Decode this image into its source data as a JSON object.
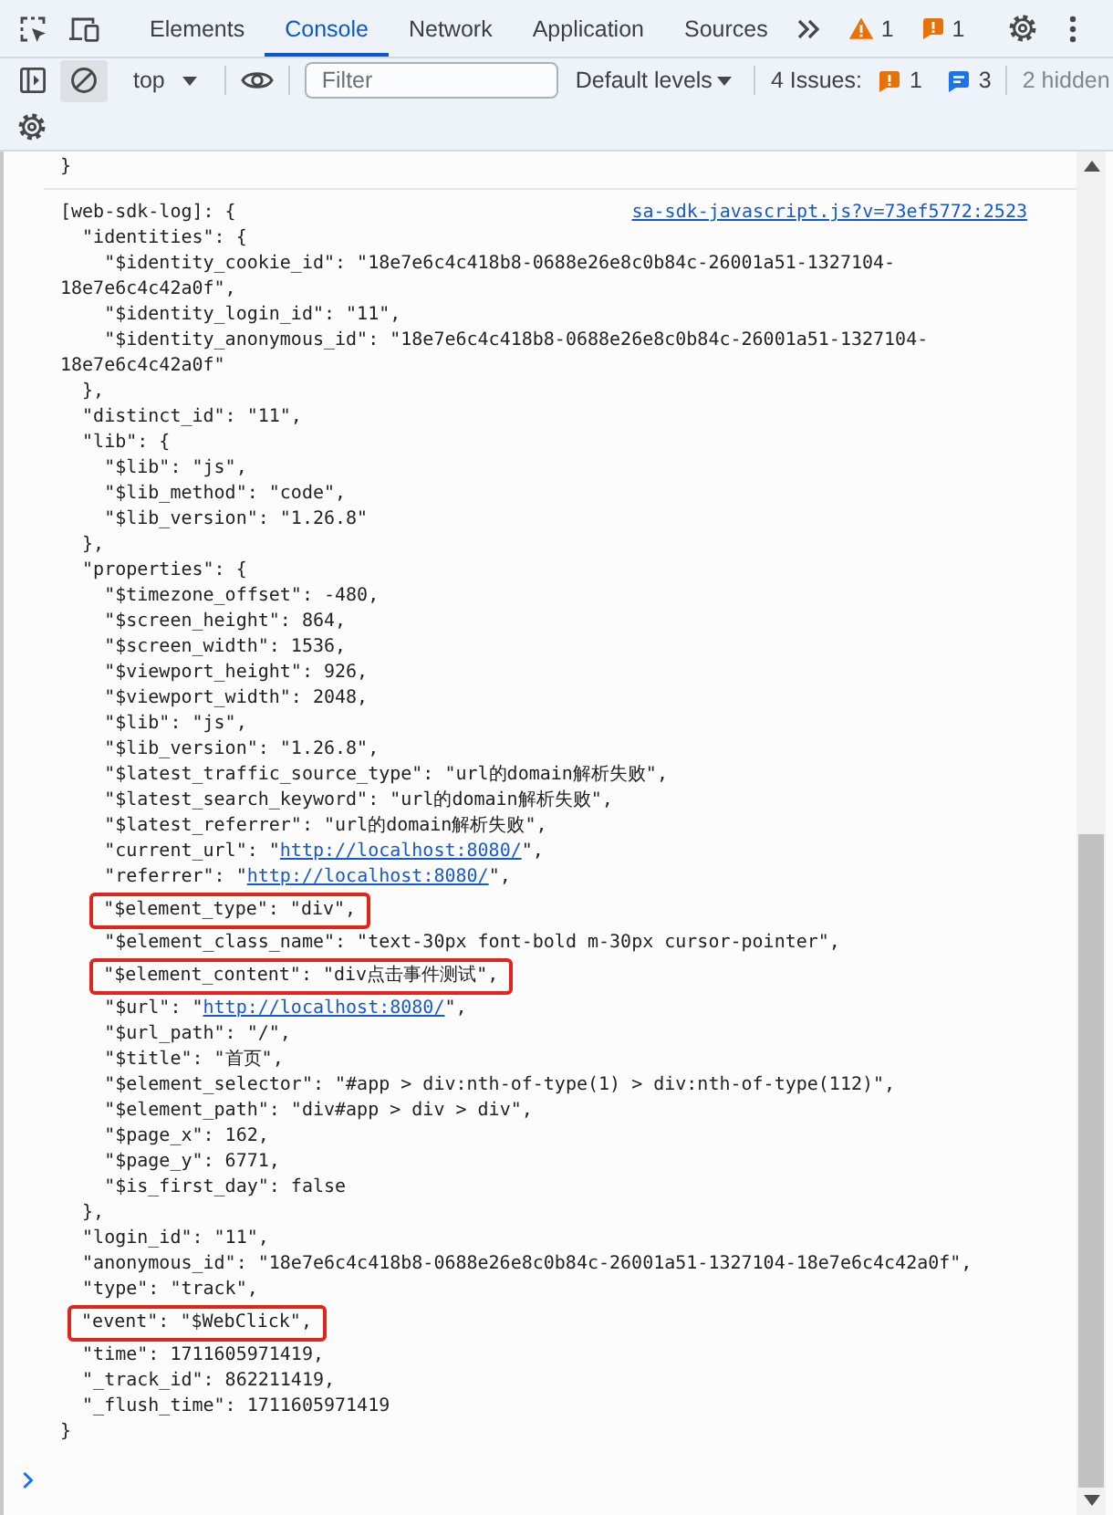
{
  "toolbar": {
    "tabs": [
      {
        "label": "Elements",
        "selected": false
      },
      {
        "label": "Console",
        "selected": true
      },
      {
        "label": "Network",
        "selected": false
      },
      {
        "label": "Application",
        "selected": false
      },
      {
        "label": "Sources",
        "selected": false
      }
    ],
    "warning_count": "1",
    "issue_count": "1"
  },
  "console_toolbar": {
    "clear_button": {
      "hovered": true
    },
    "context": "top",
    "filter": {
      "placeholder": "Filter"
    },
    "levels": "Default levels",
    "issues": {
      "label": "4 Issues:",
      "errors": "1",
      "messages": "3"
    },
    "hidden": "2 hidden"
  },
  "console": {
    "entries": [
      {
        "lines": [
          {
            "text": "}",
            "highlighted": false
          }
        ]
      },
      {
        "source": "sa-sdk-javascript.js?v=73ef5772:2523",
        "lines": [
          {
            "text": "[web-sdk-log]: {",
            "highlighted": false,
            "children": [
              {
                "text": "\"identities\": {",
                "highlighted": false,
                "children": [
                  {
                    "text": "\"$identity_cookie_id\": \"18e7e6c4c418b8-0688e26e8c0b84c-26001a51-1327104-18e7e6c4c42a0f\",",
                    "highlighted": false
                  },
                  {
                    "text": "\"$identity_login_id\": \"11\",",
                    "highlighted": false
                  },
                  {
                    "text": "\"$identity_anonymous_id\": \"18e7e6c4c418b8-0688e26e8c0b84c-26001a51-1327104-18e7e6c4c42a0f\"",
                    "highlighted": false
                  }
                ]
              },
              {
                "text": "},",
                "highlighted": false
              },
              {
                "text": "\"distinct_id\": \"11\",",
                "highlighted": false
              },
              {
                "text": "\"lib\": {",
                "highlighted": false,
                "children": [
                  {
                    "text": "\"$lib\": \"js\",",
                    "highlighted": false
                  },
                  {
                    "text": "\"$lib_method\": \"code\",",
                    "highlighted": false
                  },
                  {
                    "text": "\"$lib_version\": \"1.26.8\"",
                    "highlighted": false
                  }
                ]
              },
              {
                "text": "},",
                "highlighted": false
              },
              {
                "text": "\"properties\": {",
                "highlighted": false,
                "children": [
                  {
                    "text": "\"$timezone_offset\": -480,",
                    "highlighted": false
                  },
                  {
                    "text": "\"$screen_height\": 864,",
                    "highlighted": false
                  },
                  {
                    "text": "\"$screen_width\": 1536,",
                    "highlighted": false
                  },
                  {
                    "text": "\"$viewport_height\": 926,",
                    "highlighted": false
                  },
                  {
                    "text": "\"$viewport_width\": 2048,",
                    "highlighted": false
                  },
                  {
                    "text": "\"$lib\": \"js\",",
                    "highlighted": false
                  },
                  {
                    "text": "\"$lib_version\": \"1.26.8\",",
                    "highlighted": false
                  },
                  {
                    "text": "\"$latest_traffic_source_type\": \"url的domain解析失败\",",
                    "highlighted": false
                  },
                  {
                    "text": "\"$latest_search_keyword\": \"url的domain解析失败\",",
                    "highlighted": false
                  },
                  {
                    "text": "\"$latest_referrer\": \"url的domain解析失败\",",
                    "highlighted": false
                  },
                  {
                    "text": "\"current_url\": \"",
                    "link": "http://localhost:8080/",
                    "tail": "\",",
                    "highlighted": false
                  },
                  {
                    "text": "\"referrer\": \"",
                    "link": "http://localhost:8080/",
                    "tail": "\",",
                    "highlighted": false
                  },
                  {
                    "text": "\"$element_type\": \"div\",",
                    "highlighted": true
                  },
                  {
                    "text": "\"$element_class_name\": \"text-30px font-bold m-30px cursor-pointer\",",
                    "highlighted": false
                  },
                  {
                    "text": "\"$element_content\": \"div点击事件测试\",",
                    "highlighted": true
                  },
                  {
                    "text": "\"$url\": \"",
                    "link": "http://localhost:8080/",
                    "tail": "\",",
                    "highlighted": false
                  },
                  {
                    "text": "\"$url_path\": \"/\",",
                    "highlighted": false
                  },
                  {
                    "text": "\"$title\": \"首页\",",
                    "highlighted": false
                  },
                  {
                    "text": "\"$element_selector\": \"#app > div:nth-of-type(1) > div:nth-of-type(112)\",",
                    "highlighted": false
                  },
                  {
                    "text": "\"$element_path\": \"div#app > div > div\",",
                    "highlighted": false
                  },
                  {
                    "text": "\"$page_x\": 162,",
                    "highlighted": false
                  },
                  {
                    "text": "\"$page_y\": 6771,",
                    "highlighted": false
                  },
                  {
                    "text": "\"$is_first_day\": false",
                    "highlighted": false
                  }
                ]
              },
              {
                "text": "},",
                "highlighted": false
              },
              {
                "text": "\"login_id\": \"11\",",
                "highlighted": false
              },
              {
                "text": "\"anonymous_id\": \"18e7e6c4c418b8-0688e26e8c0b84c-26001a51-1327104-18e7e6c4c42a0f\",",
                "highlighted": false
              },
              {
                "text": "\"type\": \"track\",",
                "highlighted": false
              },
              {
                "text": "\"event\": \"$WebClick\",",
                "highlighted": true
              },
              {
                "text": "\"time\": 1711605971419,",
                "highlighted": false
              },
              {
                "text": "\"_track_id\": 862211419,",
                "highlighted": false
              },
              {
                "text": "\"_flush_time\": 1711605971419",
                "highlighted": false
              }
            ]
          },
          {
            "text": "}",
            "highlighted": false
          }
        ]
      }
    ]
  }
}
